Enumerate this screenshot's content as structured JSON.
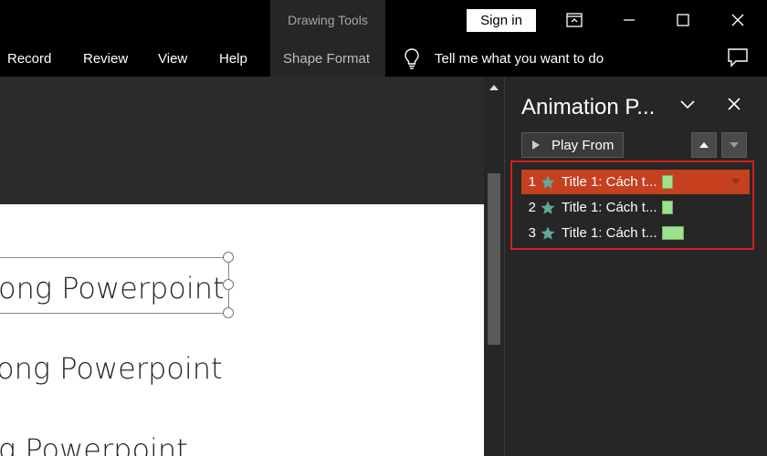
{
  "titlebar": {
    "context_group": "Drawing Tools",
    "sign_in": "Sign in",
    "controls": [
      "ribbon-display-icon",
      "minimize-icon",
      "maximize-icon",
      "close-icon"
    ]
  },
  "ribbon": {
    "tabs": [
      "Record",
      "Review",
      "View",
      "Help",
      "Shape Format"
    ],
    "tell_me": "Tell me what you want to do"
  },
  "slide": {
    "lines": [
      "ong Powerpoint",
      "ong Powerpoint",
      "g Powerpoint"
    ]
  },
  "animation_pane": {
    "title": "Animation P...",
    "play_button": "Play From",
    "items": [
      {
        "num": "1",
        "label": "Title 1: Cách t...",
        "selected": true,
        "bar_width_fraction": 0.2
      },
      {
        "num": "2",
        "label": "Title 1: Cách t...",
        "selected": false,
        "bar_width_fraction": 0.2
      },
      {
        "num": "3",
        "label": "Title 1: Cách t...",
        "selected": false,
        "bar_width_fraction": 0.4
      }
    ]
  },
  "colors": {
    "accent_selected": "#c5401f",
    "highlight_frame": "#d02020",
    "timing_bar": "#9fe18f",
    "star": "#5fa89a"
  }
}
